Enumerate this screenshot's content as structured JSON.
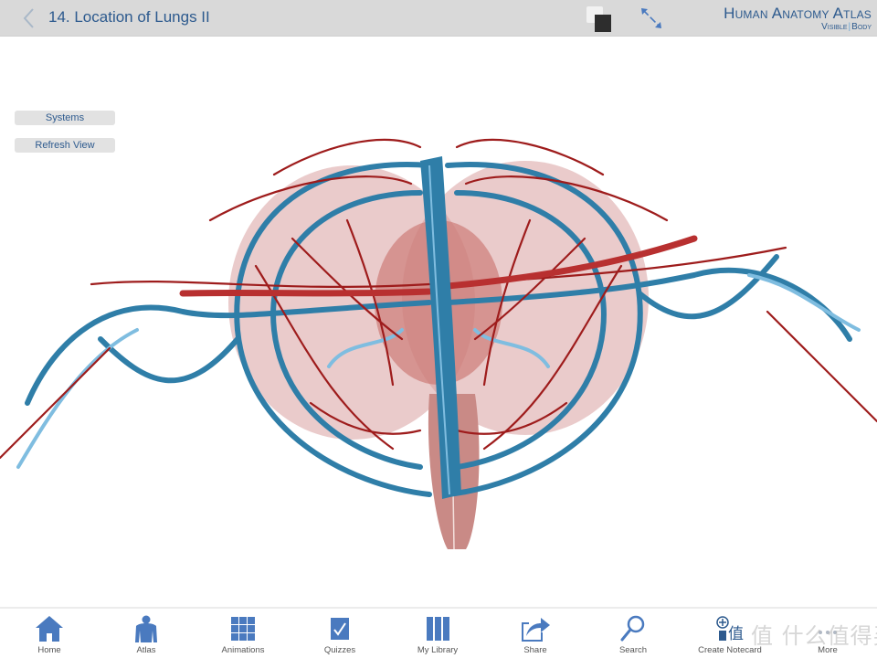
{
  "header": {
    "back_icon": "chevron-left-icon",
    "title": "14. Location of Lungs II",
    "layer_toggle_icon": "layer-toggle-icon",
    "fullscreen_icon": "expand-arrows-icon",
    "brand": {
      "title": "Human Anatomy Atlas",
      "sub_left": "Visible",
      "sub_right": "Body"
    }
  },
  "side_buttons": {
    "systems": "Systems",
    "refresh": "Refresh View"
  },
  "viewport": {
    "subject": "3D circulatory system model (arteries and veins) around lungs",
    "artery_color": "#9e1c1c",
    "vein_color": "#2f7ea8",
    "light_vein_color": "#7fbde0",
    "tissue_color": "#d9a0a0"
  },
  "tabbar": {
    "icon_color": "#4a7abf",
    "tabs": [
      {
        "label": "Home",
        "icon": "home-icon"
      },
      {
        "label": "Atlas",
        "icon": "body-icon"
      },
      {
        "label": "Animations",
        "icon": "grid-icon"
      },
      {
        "label": "Quizzes",
        "icon": "checkbox-icon"
      },
      {
        "label": "My Library",
        "icon": "library-icon"
      },
      {
        "label": "Share",
        "icon": "share-icon"
      },
      {
        "label": "Search",
        "icon": "search-icon"
      },
      {
        "label": "Create Notecard",
        "icon": "notecard-icon"
      },
      {
        "label": "More",
        "icon": "more-icon"
      }
    ]
  },
  "watermark": "值 什么值得买"
}
